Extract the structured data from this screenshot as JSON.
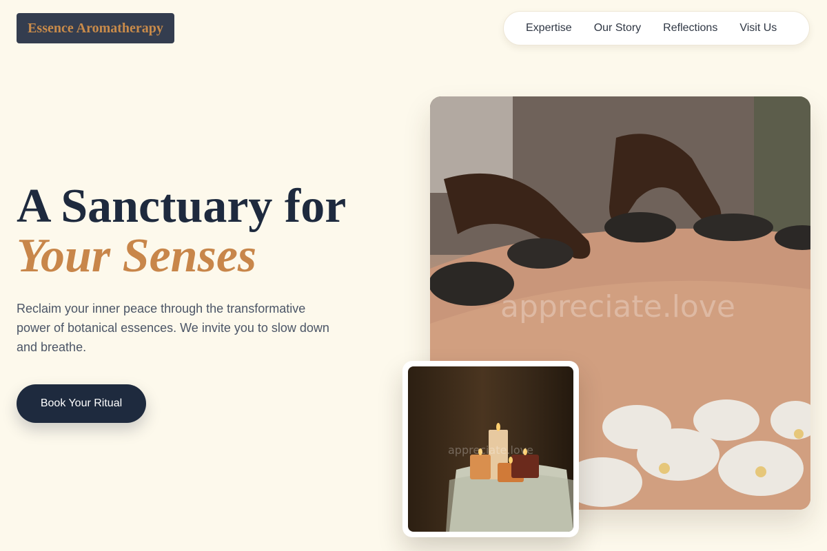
{
  "brand": {
    "name": "Essence Aromatherapy"
  },
  "nav": {
    "items": [
      {
        "label": "Expertise"
      },
      {
        "label": "Our Story"
      },
      {
        "label": "Reflections"
      },
      {
        "label": "Visit Us"
      }
    ]
  },
  "hero": {
    "title_line1": "A Sanctuary for",
    "title_line2": "Your Senses",
    "description": "Reclaim your inner peace through the transformative power of botanical essences. We invite you to slow down and breathe.",
    "cta_label": "Book Your Ritual",
    "main_image_watermark": "appreciate.love",
    "secondary_image_watermark": "appreciate.love"
  },
  "colors": {
    "background": "#fdf9ec",
    "navy": "#1e2a3e",
    "accent": "#c8864a"
  }
}
